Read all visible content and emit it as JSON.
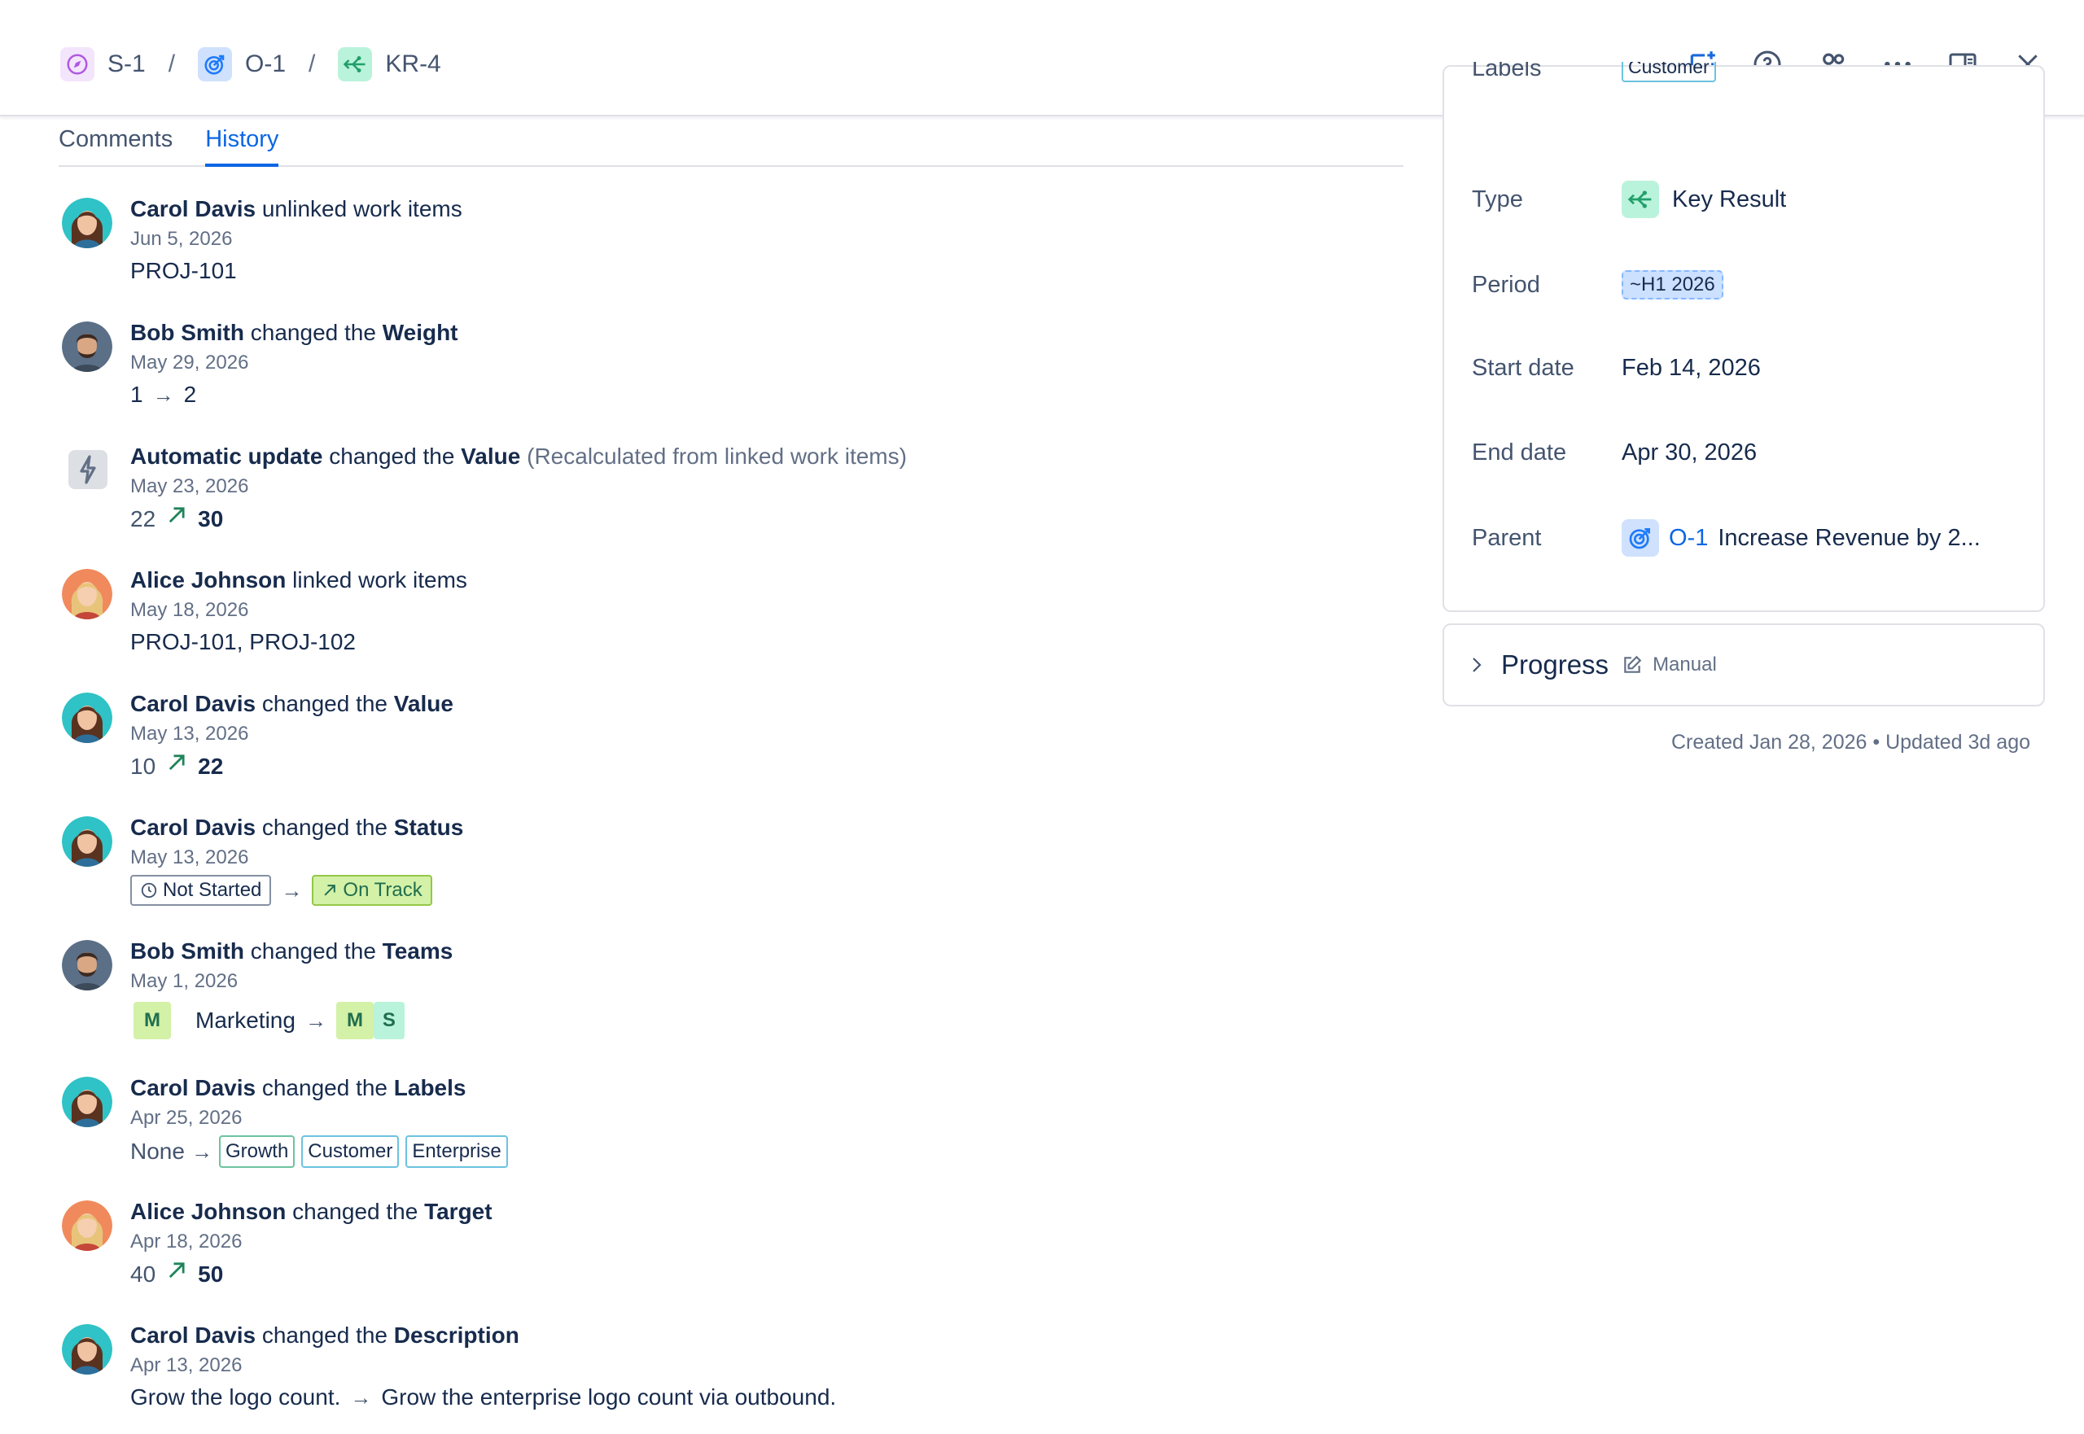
{
  "breadcrumbs": [
    {
      "key": "S-1",
      "icon": "compass-icon",
      "color": "#af59e1"
    },
    {
      "key": "O-1",
      "icon": "target-icon",
      "color": "#1d7afc"
    },
    {
      "key": "KR-4",
      "icon": "key-result-icon",
      "color": "#22a06b"
    }
  ],
  "breadcrumb_separator": "/",
  "toolbar_icons": [
    "feedback-icon",
    "help-icon",
    "people-icon",
    "more-icon",
    "panel-icon",
    "close-icon"
  ],
  "tabs": [
    {
      "label": "Comments",
      "active": false
    },
    {
      "label": "History",
      "active": true
    }
  ],
  "history": [
    {
      "actor": "Carol Davis",
      "action": "unlinked work items",
      "date": "Jun 5, 2026",
      "detail": "PROJ-101"
    },
    {
      "actor": "Bob Smith",
      "action": "changed the",
      "field": "Weight",
      "date": "May 29, 2026",
      "from": "1",
      "to": "2"
    },
    {
      "actor": "Automatic update",
      "action": "changed the",
      "field": "Value",
      "note": "(Recalculated from linked work items)",
      "date": "May 23, 2026",
      "from": "22",
      "to": "30"
    },
    {
      "actor": "Alice Johnson",
      "action": "linked work items",
      "date": "May 18, 2026",
      "detail": "PROJ-101, PROJ-102"
    },
    {
      "actor": "Carol Davis",
      "action": "changed the",
      "field": "Value",
      "date": "May 13, 2026",
      "from": "10",
      "to": "22"
    },
    {
      "actor": "Carol Davis",
      "action": "changed the",
      "field": "Status",
      "date": "May 13, 2026",
      "from": "Not Started",
      "to": "On Track"
    },
    {
      "actor": "Bob Smith",
      "action": "changed the",
      "field": "Teams",
      "date": "May 1, 2026",
      "from_badge": "M",
      "from": "Marketing",
      "to_badges": [
        "M",
        "S"
      ]
    },
    {
      "actor": "Carol Davis",
      "action": "changed the",
      "field": "Labels",
      "date": "Apr 25, 2026",
      "from": "None",
      "to_labels": [
        "Growth",
        "Customer",
        "Enterprise"
      ]
    },
    {
      "actor": "Alice Johnson",
      "action": "changed the",
      "field": "Target",
      "date": "Apr 18, 2026",
      "from": "40",
      "to": "50"
    },
    {
      "actor": "Carol Davis",
      "action": "changed the",
      "field": "Description",
      "date": "Apr 13, 2026",
      "from": "Grow the logo count.",
      "to": "Grow the enterprise logo count via outbound."
    }
  ],
  "details": {
    "labels_label": "Labels",
    "labels_value": "Customer",
    "type_label": "Type",
    "type_value": "Key Result",
    "period_label": "Period",
    "period_value": "~H1 2026",
    "start_label": "Start date",
    "start_value": "Feb 14, 2026",
    "end_label": "End date",
    "end_value": "Apr 30, 2026",
    "parent_label": "Parent",
    "parent_key": "O-1",
    "parent_title": "Increase Revenue by 2..."
  },
  "progress": {
    "title": "Progress",
    "mode": "Manual"
  },
  "meta": "Created Jan 28, 2026 • Updated 3d ago",
  "colors": {
    "accent": "#0c66e4",
    "up_arrow": "#1f845a",
    "on_track_bg": "#d3f1a7",
    "team_m": "#d3f1a7",
    "team_s": "#baf3db"
  }
}
